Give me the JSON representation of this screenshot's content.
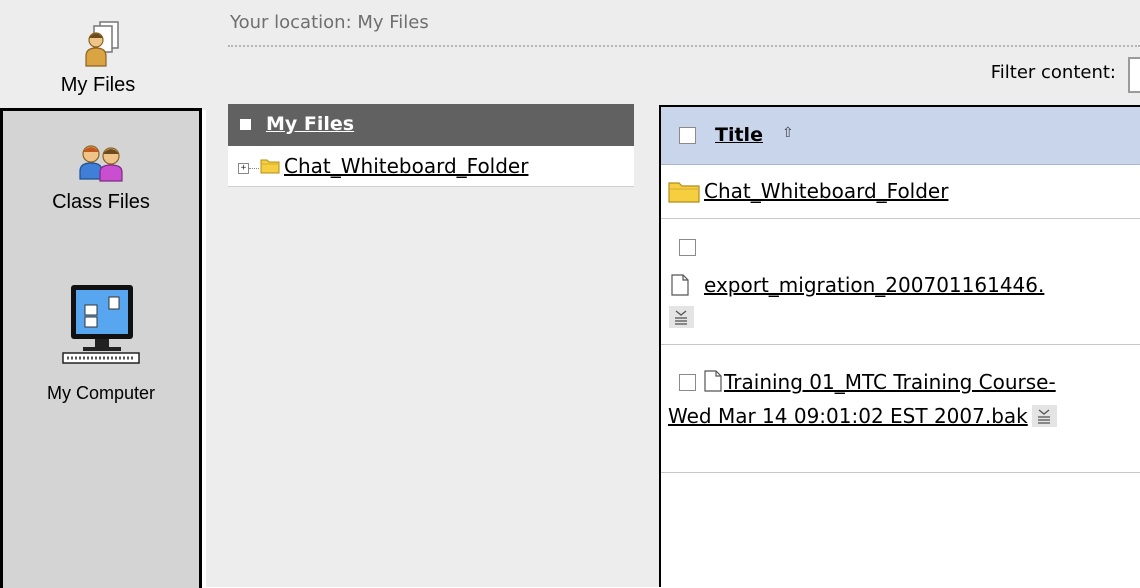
{
  "nav": {
    "my_files": "My Files",
    "class_files": "Class Files",
    "my_computer": "My Computer"
  },
  "location": {
    "text": "Your location: My Files"
  },
  "filter": {
    "label": "Filter content:",
    "value": ""
  },
  "tree": {
    "root": "My Files",
    "children": [
      {
        "label": "Chat_Whiteboard_Folder"
      }
    ]
  },
  "content": {
    "column_title": "Title",
    "rows": [
      {
        "type": "folder",
        "name": "Chat_Whiteboard_Folder"
      },
      {
        "type": "file",
        "name": "export_migration_200701161446."
      },
      {
        "type": "file",
        "name": "Training 01_MTC Training Course-Wed Mar 14 09:01:02 EST 2007.bak"
      }
    ]
  },
  "colors": {
    "nav_panel": "#d4d4d4",
    "tree_header": "#616161",
    "column_header": "#c9d5ea",
    "folder": "#f5cf3f"
  },
  "icons": {
    "my_files": "person-document-icon",
    "class_files": "users-group-icon",
    "my_computer": "computer-icon",
    "folder": "folder-icon",
    "file": "document-icon",
    "sort": "sort-ascending-icon",
    "file_menu": "file-menu-icon"
  }
}
